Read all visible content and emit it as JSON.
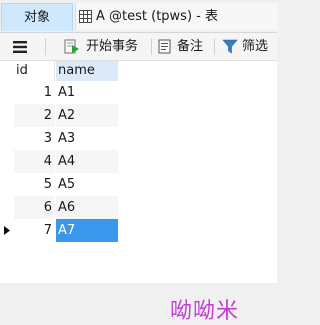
{
  "tabs": [
    {
      "label": "对象"
    },
    {
      "label": "A @test (tpws) - 表"
    }
  ],
  "toolbar": {
    "begin_transaction": "开始事务",
    "notes": "备注",
    "filter": "筛选"
  },
  "grid": {
    "columns": [
      "id",
      "name"
    ],
    "rows": [
      {
        "id": "1",
        "name": "A1"
      },
      {
        "id": "2",
        "name": "A2"
      },
      {
        "id": "3",
        "name": "A3"
      },
      {
        "id": "4",
        "name": "A4"
      },
      {
        "id": "5",
        "name": "A5"
      },
      {
        "id": "6",
        "name": "A6"
      },
      {
        "id": "7",
        "name": "A7"
      }
    ],
    "selected_row": 7
  },
  "watermark": "呦呦米",
  "colors": {
    "selection": "#3a98ea",
    "active_tab": "#cfe8fb",
    "watermark": "#c23dd4"
  }
}
